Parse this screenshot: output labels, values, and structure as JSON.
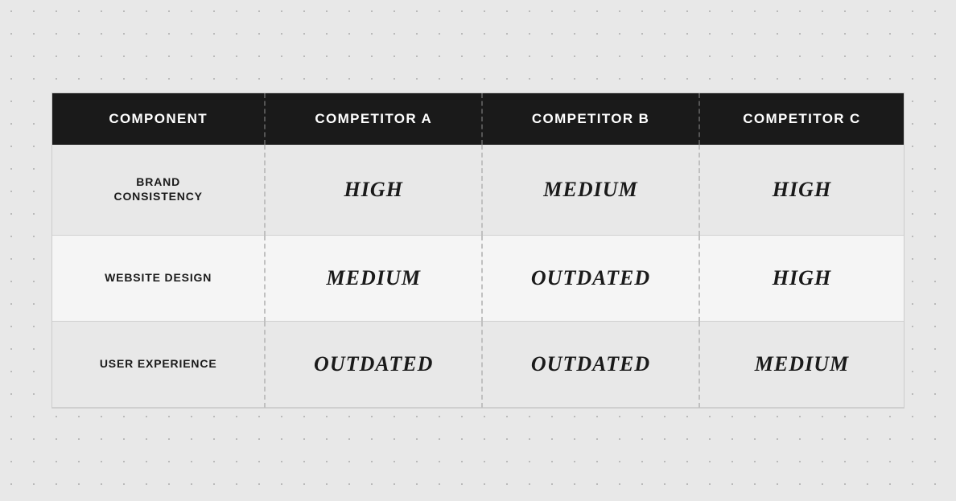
{
  "table": {
    "headers": [
      {
        "label": "COMPONENT"
      },
      {
        "label": "COMPETITOR A"
      },
      {
        "label": "COMPETITOR B"
      },
      {
        "label": "COMPETITOR C"
      }
    ],
    "rows": [
      {
        "component": "BRAND\nCONSISTENCY",
        "competitor_a": "HIGH",
        "competitor_b": "MEDIUM",
        "competitor_c": "HIGH"
      },
      {
        "component": "WEBSITE DESIGN",
        "competitor_a": "MEDIUM",
        "competitor_b": "OUTDATED",
        "competitor_c": "HIGH"
      },
      {
        "component": "USER EXPERIENCE",
        "competitor_a": "OUTDATED",
        "competitor_b": "OUTDATED",
        "competitor_c": "MEDIUM"
      }
    ]
  }
}
